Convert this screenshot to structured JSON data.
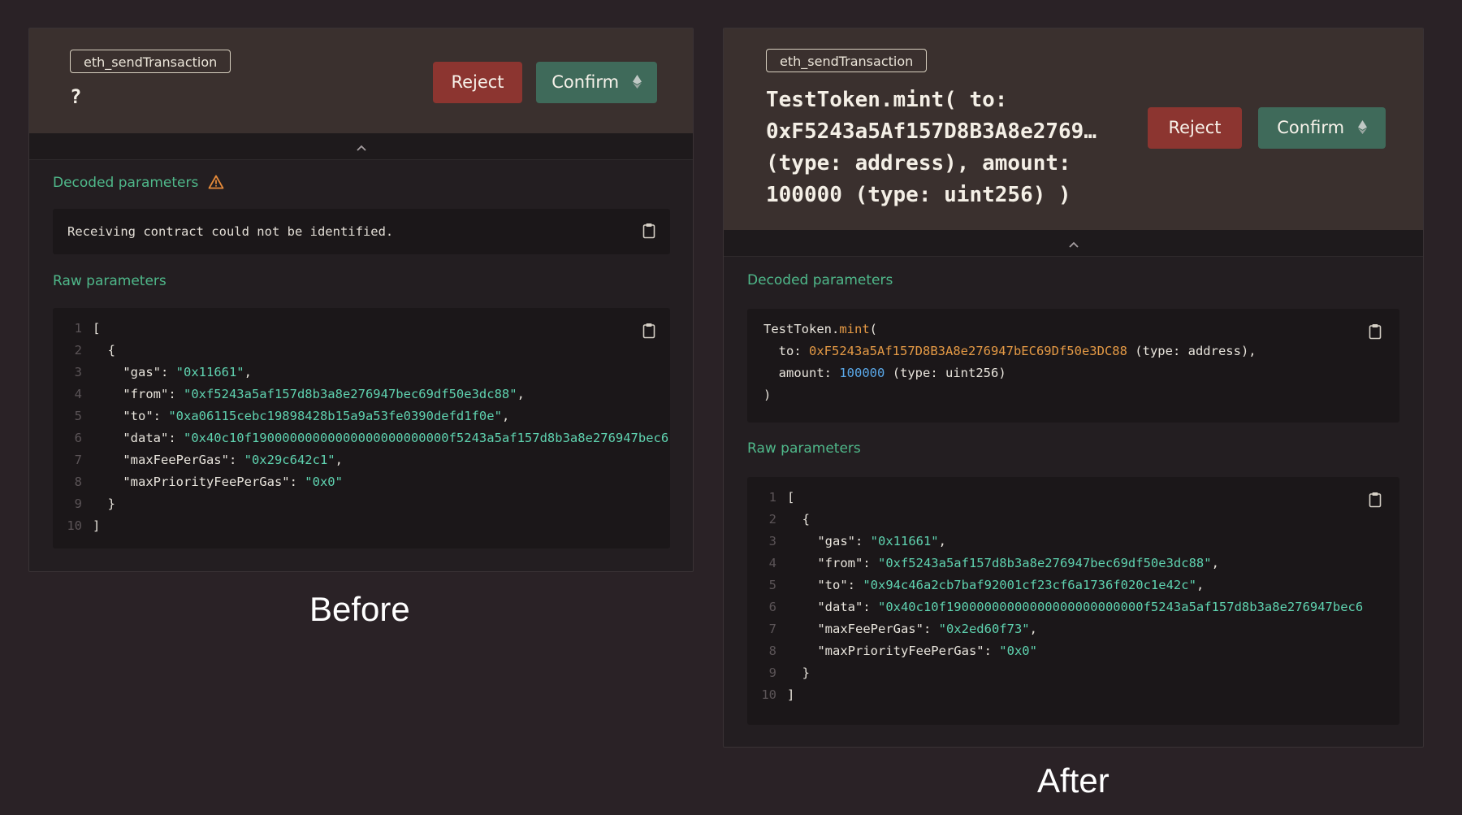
{
  "before": {
    "method": "eth_sendTransaction",
    "title": "?",
    "reject_label": "Reject",
    "confirm_label": "Confirm",
    "decoded_label": "Decoded parameters",
    "decoded_message": "Receiving contract could not be identified.",
    "raw_label": "Raw parameters",
    "raw": {
      "gas": "\"0x11661\"",
      "from": "\"0xf5243a5af157d8b3a8e276947bec69df50e3dc88\"",
      "to": "\"0xa06115cebc19898428b15a9a53fe0390defd1f0e\"",
      "data": "\"0x40c10f19000000000000000000000000f5243a5af157d8b3a8e276947bec6",
      "maxFeePerGas": "\"0x29c642c1\"",
      "maxPriorityFeePerGas": "\"0x0\""
    },
    "caption": "Before"
  },
  "after": {
    "method": "eth_sendTransaction",
    "title": "TestToken.mint( to: 0xF5243a5Af157D8B3A8e2769… (type: address), amount: 100000 (type: uint256) )",
    "reject_label": "Reject",
    "confirm_label": "Confirm",
    "decoded_label": "Decoded parameters",
    "decoded": {
      "contract": "TestToken",
      "fn": "mint",
      "to_label": "to:",
      "to_value": "0xF5243a5Af157D8B3A8e276947bEC69Df50e3DC88",
      "to_type": "(type: address),",
      "amount_label": "amount:",
      "amount_value": "100000",
      "amount_type": "(type: uint256)"
    },
    "raw_label": "Raw parameters",
    "raw": {
      "gas": "\"0x11661\"",
      "from": "\"0xf5243a5af157d8b3a8e276947bec69df50e3dc88\"",
      "to": "\"0x94c46a2cb7baf92001cf23cf6a1736f020c1e42c\"",
      "data": "\"0x40c10f19000000000000000000000000f5243a5af157d8b3a8e276947bec6",
      "maxFeePerGas": "\"0x2ed60f73\"",
      "maxPriorityFeePerGas": "\"0x0\""
    },
    "caption": "After"
  },
  "colors": {
    "background": "#2a2226",
    "header": "#3a302e",
    "reject": "#8c3530",
    "confirm": "#3f6a5a",
    "accent_green": "#4fb88a",
    "string_teal": "#5fd3b0",
    "function_orange": "#e59a45",
    "number_blue": "#5aa8e8"
  },
  "icons": [
    "eth-icon",
    "chevron-up-icon",
    "warning-icon",
    "clipboard-icon"
  ]
}
